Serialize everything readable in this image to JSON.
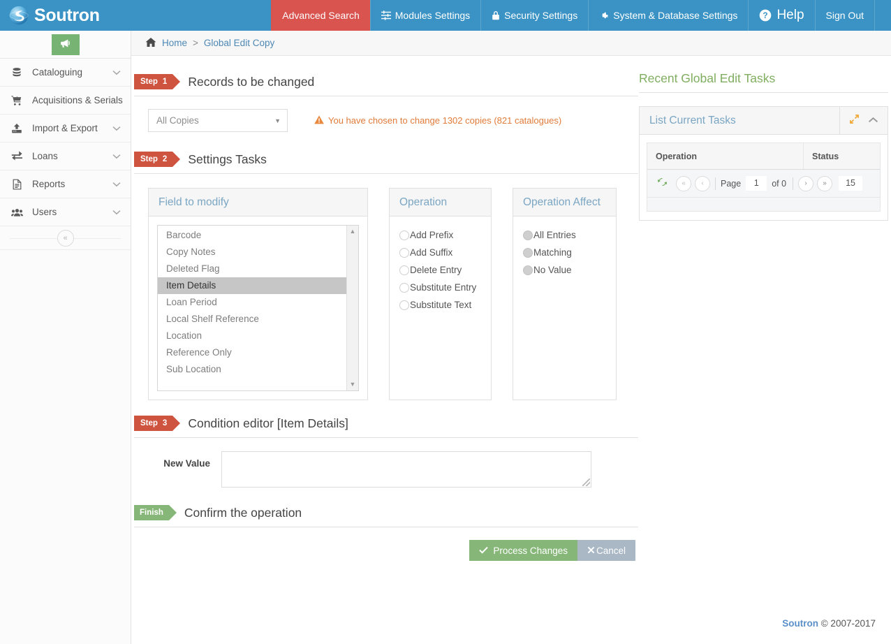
{
  "topnav": {
    "brand": "Soutron",
    "items": [
      {
        "label": "Advanced Search",
        "icon": "",
        "active": true
      },
      {
        "label": "Modules Settings",
        "icon": "sliders-icon"
      },
      {
        "label": "Security Settings",
        "icon": "lock-icon"
      },
      {
        "label": "System & Database Settings",
        "icon": "gear-icon"
      },
      {
        "label": "Help",
        "icon": "question-circle-icon"
      },
      {
        "label": "Sign Out",
        "icon": ""
      }
    ]
  },
  "sidebar": {
    "announce_icon": "megaphone-icon",
    "items": [
      {
        "label": "Cataloguing",
        "icon": "database-icon"
      },
      {
        "label": "Acquisitions & Serials",
        "icon": "cart-plus-icon"
      },
      {
        "label": "Import & Export",
        "icon": "upload-icon"
      },
      {
        "label": "Loans",
        "icon": "exchange-icon"
      },
      {
        "label": "Reports",
        "icon": "file-text-icon"
      },
      {
        "label": "Users",
        "icon": "users-icon"
      }
    ],
    "collapse_icon": "double-chevron-left-icon"
  },
  "breadcrumb": {
    "home_icon": "home-icon",
    "home": "Home",
    "separator": ">",
    "current": "Global Edit Copy"
  },
  "step1": {
    "badge": "Step",
    "number": "1",
    "title": "Records to be changed",
    "select_value": "All Copies",
    "warning_icon": "warning-triangle-icon",
    "warning": "You have chosen to change 1302 copies (821 catalogues)"
  },
  "step2": {
    "badge": "Step",
    "number": "2",
    "title": "Settings Tasks",
    "field_panel": {
      "title": "Field to modify",
      "options": [
        "Barcode",
        "Copy Notes",
        "Deleted Flag",
        "Item Details",
        "Loan Period",
        "Local Shelf Reference",
        "Location",
        "Reference Only",
        "Sub Location"
      ],
      "selected": "Item Details"
    },
    "operation_panel": {
      "title": "Operation",
      "options": [
        "Add Prefix",
        "Add Suffix",
        "Delete Entry",
        "Substitute Entry",
        "Substitute Text"
      ],
      "selected": ""
    },
    "affect_panel": {
      "title": "Operation Affect",
      "options": [
        "All Entries",
        "Matching",
        "No Value"
      ],
      "selected": "",
      "disabled": true
    }
  },
  "step3": {
    "badge": "Step",
    "number": "3",
    "title": "Condition editor [Item Details]",
    "new_value_label": "New Value",
    "new_value": "",
    "new_value_placeholder": ""
  },
  "finish": {
    "badge": "Finish",
    "title": "Confirm the operation",
    "process_icon": "check-icon",
    "process_label": "Process Changes",
    "cancel_icon": "times-icon",
    "cancel_label": "Cancel"
  },
  "recent_tasks": {
    "title": "Recent Global Edit Tasks",
    "panel_title": "List Current Tasks",
    "expand_icon": "expand-arrows-icon",
    "collapse_icon": "chevron-up-icon",
    "columns": [
      "Operation",
      "Status"
    ],
    "rows": [],
    "pager": {
      "refresh_icon": "refresh-icon",
      "first_icon": "double-chevron-left-icon",
      "prev_icon": "chevron-left-icon",
      "page_label": "Page",
      "page_value": "1",
      "of_label": "of 0",
      "next_icon": "chevron-right-icon",
      "last_icon": "double-chevron-right-icon",
      "page_size": "15"
    }
  },
  "footer": {
    "brand": "Soutron",
    "copyright": "© 2007-2017"
  },
  "colors": {
    "nav_blue": "#3a93c4",
    "active_red": "#d9534f",
    "step_red": "#cf5440",
    "finish_green": "#86b778",
    "warn_orange": "#e07b39",
    "panel_title_blue": "#7aa6c4",
    "tasks_title_green": "#7fae5f"
  }
}
